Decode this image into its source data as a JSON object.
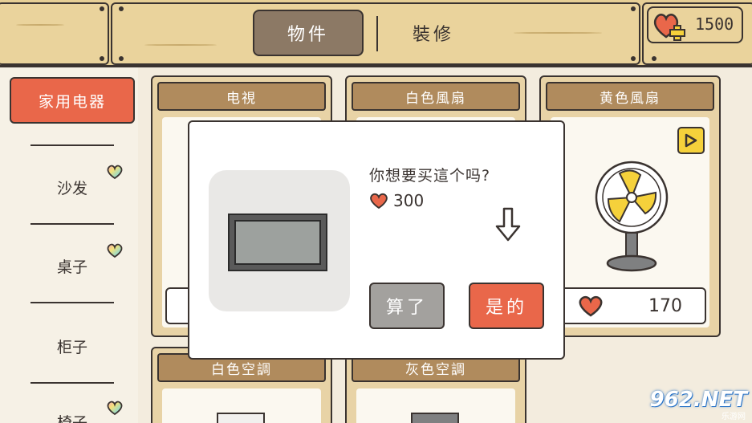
{
  "tabs": [
    {
      "label": "物件",
      "active": true
    },
    {
      "label": "裝修",
      "active": false
    }
  ],
  "hearts": {
    "value": "1500",
    "icon": "heart-plus-icon"
  },
  "sidebar": {
    "active_category": "家用电器",
    "items": [
      {
        "label": "沙发",
        "badge": "rainbow-heart-icon"
      },
      {
        "label": "桌子",
        "badge": "rainbow-heart-icon"
      },
      {
        "label": "柜子",
        "badge": ""
      },
      {
        "label": "椅子",
        "badge": "rainbow-heart-icon"
      }
    ]
  },
  "cards": [
    {
      "title": "电視"
    },
    {
      "title": "白色風扇"
    },
    {
      "title": "黄色風扇",
      "price": "170",
      "has_video": true
    },
    {
      "title": "白色空調"
    },
    {
      "title": "灰色空調"
    }
  ],
  "dialog": {
    "question": "你想要买這个吗?",
    "price": "300",
    "cancel_label": "算了",
    "confirm_label": "是的"
  },
  "watermark": {
    "text": "962.NET",
    "sub": "乐游网"
  },
  "colors": {
    "accent": "#e9674a",
    "wood": "#e7cf96",
    "title_wood": "#b08b5d",
    "cancel": "#a3a19e"
  }
}
